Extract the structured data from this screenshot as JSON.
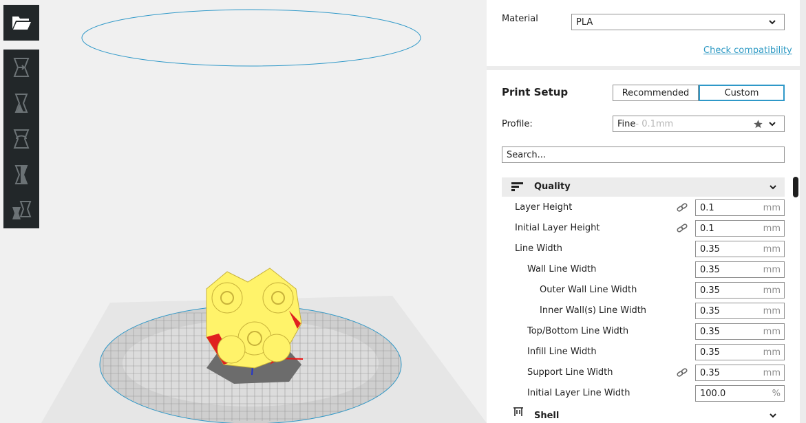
{
  "material": {
    "label": "Material",
    "selected": "PLA",
    "check_link": "Check compatibility"
  },
  "print_setup": {
    "title": "Print Setup",
    "mode_recommended": "Recommended",
    "mode_custom": "Custom",
    "profile_label": "Profile:",
    "profile_name": "Fine",
    "profile_detail": " - 0.1mm",
    "search_placeholder": "Search..."
  },
  "quality_section": {
    "title": "Quality",
    "settings": [
      {
        "label": "Layer Height",
        "value": "0.1",
        "unit": "mm",
        "linked": true,
        "indent": 0
      },
      {
        "label": "Initial Layer Height",
        "value": "0.1",
        "unit": "mm",
        "linked": true,
        "indent": 0
      },
      {
        "label": "Line Width",
        "value": "0.35",
        "unit": "mm",
        "linked": false,
        "indent": 0
      },
      {
        "label": "Wall Line Width",
        "value": "0.35",
        "unit": "mm",
        "linked": false,
        "indent": 1
      },
      {
        "label": "Outer Wall Line Width",
        "value": "0.35",
        "unit": "mm",
        "linked": false,
        "indent": 2
      },
      {
        "label": "Inner Wall(s) Line Width",
        "value": "0.35",
        "unit": "mm",
        "linked": false,
        "indent": 2
      },
      {
        "label": "Top/Bottom Line Width",
        "value": "0.35",
        "unit": "mm",
        "linked": false,
        "indent": 1
      },
      {
        "label": "Infill Line Width",
        "value": "0.35",
        "unit": "mm",
        "linked": false,
        "indent": 1
      },
      {
        "label": "Support Line Width",
        "value": "0.35",
        "unit": "mm",
        "linked": true,
        "indent": 1
      },
      {
        "label": "Initial Layer Line Width",
        "value": "100.0",
        "unit": "%",
        "linked": false,
        "indent": 1
      }
    ]
  },
  "shell_section": {
    "title": "Shell"
  },
  "toolbar": {
    "open_icon": "folder-open-icon",
    "tools": [
      "move-icon",
      "scale-icon",
      "rotate-icon",
      "mirror-icon",
      "per-model-settings-icon"
    ]
  },
  "colors": {
    "accent": "#2e98c8",
    "model": "#fff36a",
    "toolbar": "#222729"
  }
}
